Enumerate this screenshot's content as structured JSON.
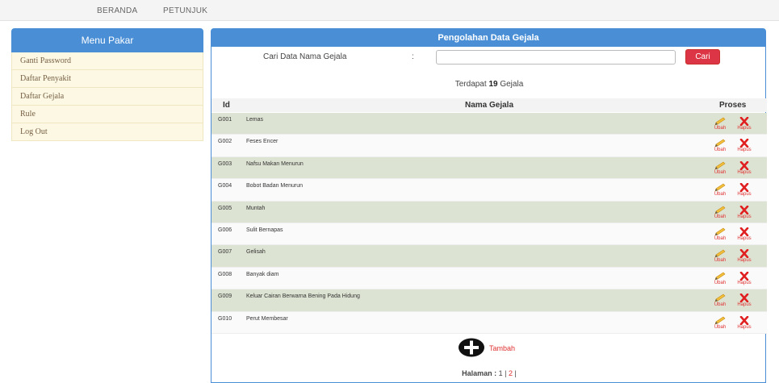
{
  "topnav": {
    "home": "BERANDA",
    "guide": "PETUNJUK"
  },
  "sidebar": {
    "title": "Menu Pakar",
    "items": [
      {
        "label": "Ganti Password"
      },
      {
        "label": "Daftar Penyakit"
      },
      {
        "label": "Daftar Gejala"
      },
      {
        "label": "Rule"
      },
      {
        "label": "Log Out"
      }
    ]
  },
  "panel": {
    "title": "Pengolahan Data Gejala",
    "search": {
      "label": "Cari Data Nama Gejala",
      "colon": ":",
      "value": "",
      "button": "Cari"
    },
    "count": {
      "prefix": "Terdapat",
      "number": "19",
      "suffix": "Gejala"
    },
    "table": {
      "headers": {
        "id": "Id",
        "name": "Nama Gejala",
        "process": "Proses"
      },
      "rows": [
        {
          "id": "G001",
          "name": "Lemas"
        },
        {
          "id": "G002",
          "name": "Feses Encer"
        },
        {
          "id": "G003",
          "name": "Nafsu Makan Menurun"
        },
        {
          "id": "G004",
          "name": "Bobot Badan Menurun"
        },
        {
          "id": "G005",
          "name": "Muntah"
        },
        {
          "id": "G006",
          "name": "Sulit Bernapas"
        },
        {
          "id": "G007",
          "name": "Gelisah"
        },
        {
          "id": "G008",
          "name": "Banyak diam"
        },
        {
          "id": "G009",
          "name": "Keluar Cairan Berwarna Bening Pada Hidung"
        },
        {
          "id": "G010",
          "name": "Perut Membesar"
        }
      ],
      "edit_label": "Ubah",
      "delete_label": "Hapus"
    },
    "add_label": "Tambah",
    "pagination": {
      "label": "Halaman :",
      "page1": "1",
      "sep1": "|",
      "page2": "2",
      "sep2": "|"
    }
  },
  "colors": {
    "accent": "#4a8fd6",
    "danger": "#dc3545",
    "row_alt": "#dde3d3",
    "sidebar_item": "#fcf8e3"
  }
}
